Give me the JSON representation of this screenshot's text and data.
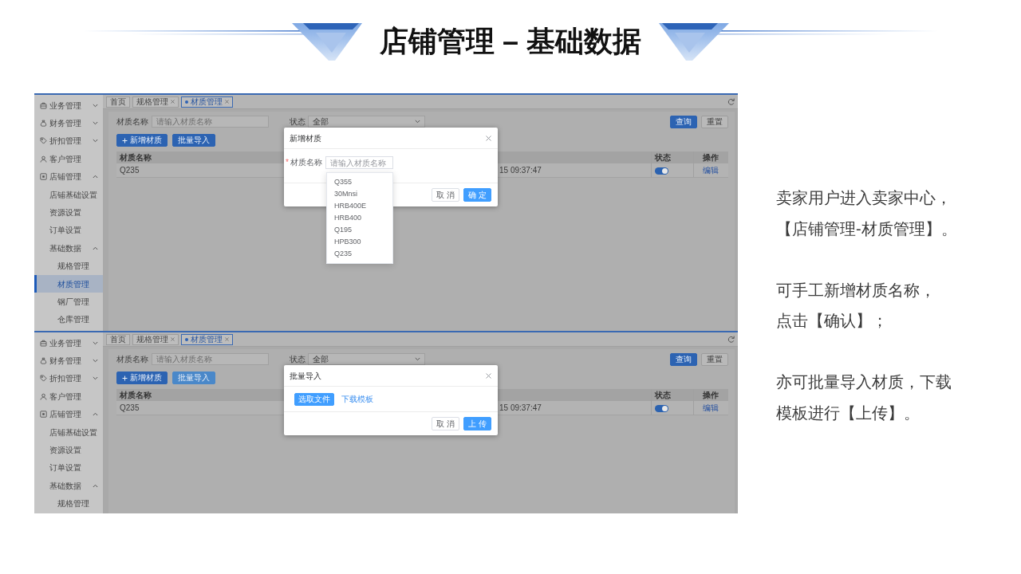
{
  "slide": {
    "title": "店铺管理 – 基础数据"
  },
  "screenshots": [
    {
      "sidebar": {
        "items": [
          {
            "label": "业务管理",
            "kind": "group",
            "expanded": false,
            "selected": false
          },
          {
            "label": "财务管理",
            "kind": "group",
            "expanded": false,
            "selected": false
          },
          {
            "label": "折扣管理",
            "kind": "group",
            "expanded": false,
            "selected": false
          },
          {
            "label": "客户管理",
            "kind": "link",
            "selected": false
          },
          {
            "label": "店铺管理",
            "kind": "group",
            "expanded": true,
            "selected": false,
            "children": [
              {
                "label": "店铺基础设置",
                "kind": "link",
                "selected": false
              },
              {
                "label": "资源设置",
                "kind": "link",
                "selected": false
              },
              {
                "label": "订单设置",
                "kind": "link",
                "selected": false
              },
              {
                "label": "基础数据",
                "kind": "group",
                "expanded": true,
                "selected": false,
                "children": [
                  {
                    "label": "规格管理",
                    "kind": "link",
                    "selected": false
                  },
                  {
                    "label": "材质管理",
                    "kind": "link",
                    "selected": true
                  },
                  {
                    "label": "钢厂管理",
                    "kind": "link",
                    "selected": false
                  },
                  {
                    "label": "仓库管理",
                    "kind": "link",
                    "selected": false
                  }
                ]
              }
            ]
          }
        ]
      },
      "tabs": [
        {
          "label": "首页",
          "selected": false,
          "closable": false
        },
        {
          "label": "规格管理",
          "selected": false,
          "closable": true
        },
        {
          "label": "材质管理",
          "selected": true,
          "closable": true
        }
      ],
      "filters": [
        {
          "kind": "input",
          "label": "材质名称",
          "placeholder": "请输入材质名称"
        },
        {
          "kind": "select",
          "label": "状态",
          "value": "全部"
        }
      ],
      "search_buttons": [
        {
          "label": "查询",
          "kind": "primary"
        },
        {
          "label": "重置",
          "kind": "default"
        }
      ],
      "toolbar": [
        {
          "label": "新增材质",
          "kind": "add",
          "focused": false
        },
        {
          "label": "批量导入",
          "kind": "import",
          "focused": false
        }
      ],
      "table": {
        "columns": [
          "材质名称",
          "状态",
          "操作"
        ],
        "rows": [
          {
            "name": "Q235",
            "time": "15 09:37:47",
            "on": true,
            "action": "编辑"
          }
        ]
      },
      "dialog": {
        "kind": "add",
        "title": "新增材质",
        "required_mark": "*",
        "field_label": "材质名称",
        "placeholder": "请输入材质名称",
        "options": [
          {
            "label": "Q355",
            "selected": false
          },
          {
            "label": "30Mnsi",
            "selected": false
          },
          {
            "label": "HRB400E",
            "selected": false
          },
          {
            "label": "HRB400",
            "selected": false
          },
          {
            "label": "Q195",
            "selected": false
          },
          {
            "label": "HPB300",
            "selected": false
          },
          {
            "label": "Q235",
            "selected": false
          }
        ],
        "buttons": [
          {
            "label": "取 消",
            "kind": "default"
          },
          {
            "label": "确 定",
            "kind": "primary"
          }
        ]
      }
    },
    {
      "sidebar": {
        "items": [
          {
            "label": "业务管理",
            "kind": "group",
            "expanded": false,
            "selected": false
          },
          {
            "label": "财务管理",
            "kind": "group",
            "expanded": false,
            "selected": false
          },
          {
            "label": "折扣管理",
            "kind": "group",
            "expanded": false,
            "selected": false
          },
          {
            "label": "客户管理",
            "kind": "link",
            "selected": false
          },
          {
            "label": "店铺管理",
            "kind": "group",
            "expanded": true,
            "selected": false,
            "children": [
              {
                "label": "店铺基础设置",
                "kind": "link",
                "selected": false
              },
              {
                "label": "资源设置",
                "kind": "link",
                "selected": false
              },
              {
                "label": "订单设置",
                "kind": "link",
                "selected": false
              },
              {
                "label": "基础数据",
                "kind": "group",
                "expanded": true,
                "selected": false,
                "children": [
                  {
                    "label": "规格管理",
                    "kind": "link",
                    "selected": false
                  }
                ]
              }
            ]
          }
        ]
      },
      "tabs": [
        {
          "label": "首页",
          "selected": false,
          "closable": false
        },
        {
          "label": "规格管理",
          "selected": false,
          "closable": true
        },
        {
          "label": "材质管理",
          "selected": true,
          "closable": true
        }
      ],
      "filters": [
        {
          "kind": "input",
          "label": "材质名称",
          "placeholder": "请输入材质名称"
        },
        {
          "kind": "select",
          "label": "状态",
          "value": "全部"
        }
      ],
      "search_buttons": [
        {
          "label": "查询",
          "kind": "primary"
        },
        {
          "label": "重置",
          "kind": "default"
        }
      ],
      "toolbar": [
        {
          "label": "新增材质",
          "kind": "add",
          "focused": false
        },
        {
          "label": "批量导入",
          "kind": "import",
          "focused": true
        }
      ],
      "table": {
        "columns": [
          "材质名称",
          "状态",
          "操作"
        ],
        "rows": [
          {
            "name": "Q235",
            "time": "15 09:37:47",
            "on": true,
            "action": "编辑"
          }
        ]
      },
      "dialog": {
        "kind": "upload",
        "title": "批量导入",
        "file_button": "选取文件",
        "template_link": "下载模板",
        "buttons": [
          {
            "label": "取 消",
            "kind": "default"
          },
          {
            "label": "上 传",
            "kind": "primary"
          }
        ]
      }
    }
  ],
  "description": [
    {
      "lines": [
        "卖家用户进入卖家中心，",
        "【店铺管理-材质管理】。"
      ]
    },
    {
      "lines": [
        "可手工新增材质名称，",
        "点击【确认】；"
      ]
    },
    {
      "lines": [
        "亦可批量导入材质，下载",
        "模板进行【上传】。"
      ]
    }
  ]
}
